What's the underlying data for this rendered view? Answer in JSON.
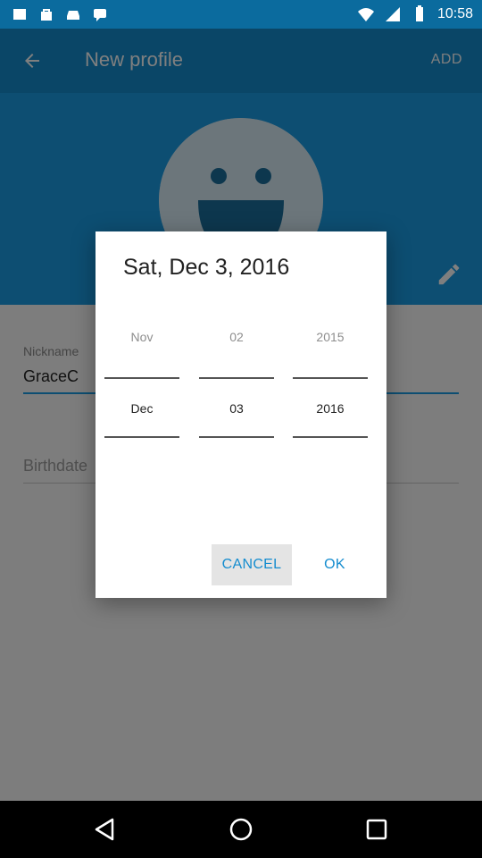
{
  "status_bar": {
    "time": "10:58",
    "icons": [
      "notification-box-icon",
      "notification-bag-icon",
      "notification-car-icon",
      "notification-chat-icon",
      "wifi-icon",
      "cellular-icon",
      "battery-icon"
    ]
  },
  "app_bar": {
    "title": "New profile",
    "action": "ADD",
    "back_icon": "arrow-back-icon"
  },
  "profile": {
    "avatar_icon": "smiley-avatar-icon",
    "edit_icon": "pencil-icon"
  },
  "form": {
    "nickname_label": "Nickname",
    "nickname_value": "GraceC",
    "birthdate_placeholder": "Birthdate"
  },
  "dialog": {
    "title": "Sat, Dec 3, 2016",
    "month": {
      "prev": "Nov",
      "selected": "Dec"
    },
    "day": {
      "prev": "02",
      "selected": "03"
    },
    "year": {
      "prev": "2015",
      "selected": "2016"
    },
    "cancel_label": "CANCEL",
    "ok_label": "OK"
  },
  "colors": {
    "app_bar": "#148ccf",
    "header": "#1a9de4",
    "accent": "#148ccf"
  },
  "nav_bar": {
    "icons": [
      "nav-back-icon",
      "nav-home-icon",
      "nav-recents-icon"
    ]
  }
}
